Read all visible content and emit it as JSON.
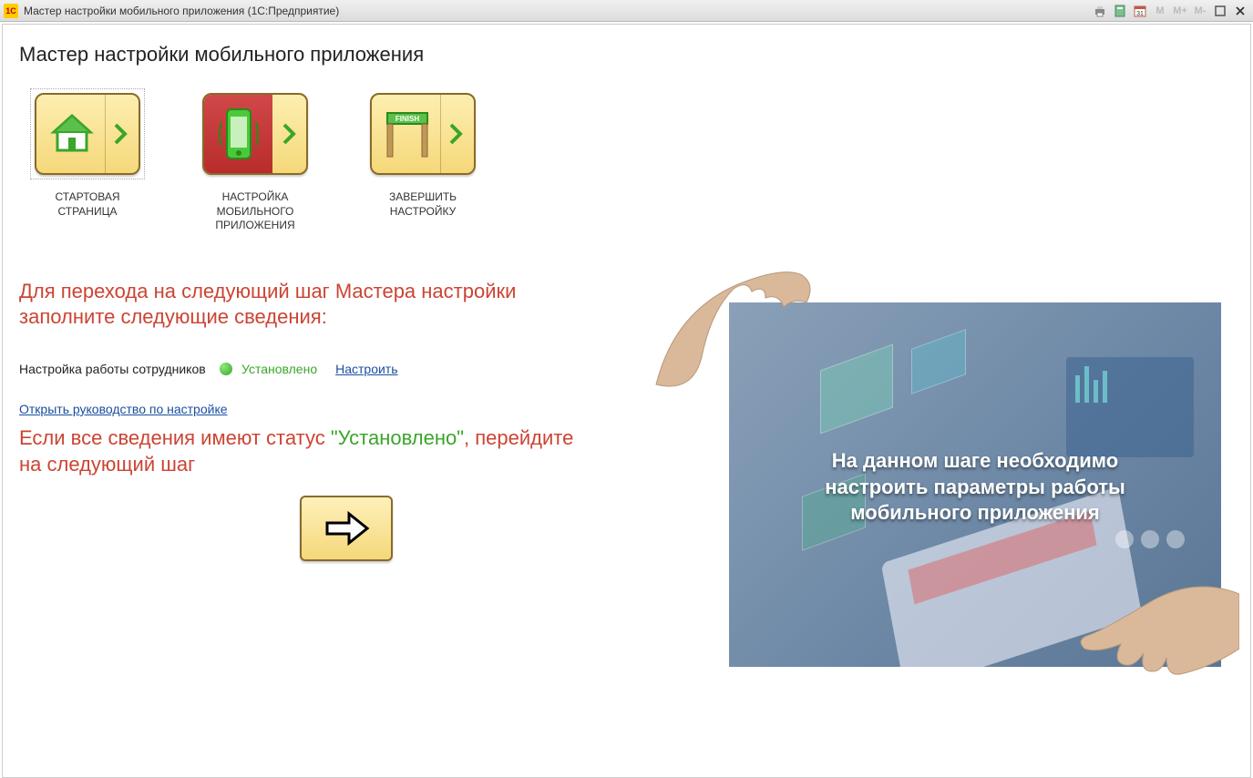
{
  "titlebar": {
    "app_icon_text": "1С",
    "title": "Мастер настройки мобильного приложения  (1С:Предприятие)",
    "m_buttons": [
      "M",
      "M+",
      "M-"
    ]
  },
  "page": {
    "title": "Мастер настройки мобильного приложения"
  },
  "steps": [
    {
      "label": "СТАРТОВАЯ\nСТРАНИЦА"
    },
    {
      "label": "НАСТРОЙКА\nМОБИЛЬНОГО\nПРИЛОЖЕНИЯ"
    },
    {
      "label": "ЗАВЕРШИТЬ\nНАСТРОЙКУ"
    }
  ],
  "instruction": "Для перехода на следующий шаг Мастера настройки заполните следующие сведения:",
  "status": {
    "label": "Настройка работы сотрудников",
    "value": "Установлено",
    "link": "Настроить"
  },
  "guide_link": "Открыть руководство по настройке",
  "next_instruction": {
    "prefix": "Если все сведения имеют статус ",
    "quoted": "\"Установлено\"",
    "suffix": ", перейдите на следующий шаг"
  },
  "illustration_text": "На данном шаге необходимо\nнастроить параметры работы\nмобильного приложения"
}
